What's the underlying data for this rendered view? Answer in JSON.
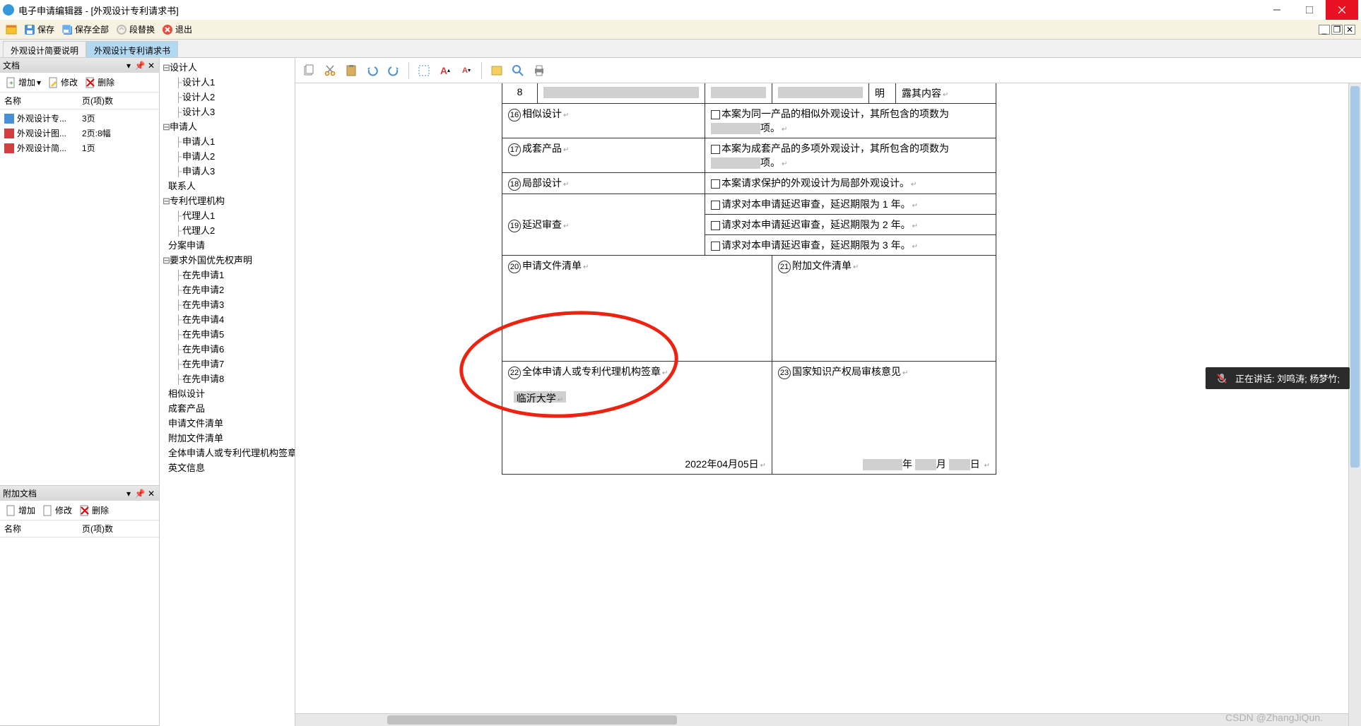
{
  "window": {
    "title": "电子申请编辑器 - [外观设计专利请求书]"
  },
  "toolbar": {
    "save": "保存",
    "save_all": "保存全部",
    "replace": "段替换",
    "exit": "退出"
  },
  "tabs": [
    {
      "label": "外观设计简要说明",
      "active": false
    },
    {
      "label": "外观设计专利请求书",
      "active": true
    }
  ],
  "panels": {
    "docs": {
      "title": "文档",
      "toolbar": {
        "add": "增加",
        "modify": "修改",
        "delete": "删除"
      },
      "columns": {
        "name": "名称",
        "pages": "页(项)数"
      },
      "items": [
        {
          "name": "外观设计专...",
          "pages": "3页",
          "icon": "doc-blue"
        },
        {
          "name": "外观设计图...",
          "pages": "2页:8幅",
          "icon": "doc-red"
        },
        {
          "name": "外观设计简...",
          "pages": "1页",
          "icon": "doc-red"
        }
      ]
    },
    "attach": {
      "title": "附加文档",
      "toolbar": {
        "add": "增加",
        "modify": "修改",
        "delete": "删除"
      },
      "columns": {
        "name": "名称",
        "pages": "页(项)数"
      },
      "items": []
    }
  },
  "outline": [
    {
      "label": "设计人",
      "children": [
        "设计人1",
        "设计人2",
        "设计人3"
      ]
    },
    {
      "label": "申请人",
      "children": [
        "申请人1",
        "申请人2",
        "申请人3"
      ]
    },
    {
      "label": "联系人",
      "children": []
    },
    {
      "label": "专利代理机构",
      "children": [
        "代理人1",
        "代理人2"
      ]
    },
    {
      "label": "分案申请",
      "children": []
    },
    {
      "label": "要求外国优先权声明",
      "children": [
        "在先申请1",
        "在先申请2",
        "在先申请3",
        "在先申请4",
        "在先申请5",
        "在先申请6",
        "在先申请7",
        "在先申请8"
      ]
    },
    {
      "label": "相似设计",
      "children": []
    },
    {
      "label": "成套产品",
      "children": []
    },
    {
      "label": "申请文件清单",
      "children": []
    },
    {
      "label": "附加文件清单",
      "children": []
    },
    {
      "label": "全体申请人或专利代理机构签章",
      "children": []
    },
    {
      "label": "英文信息",
      "children": []
    }
  ],
  "form": {
    "top_number": "8",
    "top_right1": "明",
    "top_right2": "露其内容",
    "r16_label": "相似设计",
    "r16_text": "本案为同一产品的相似外观设计，其所包含的项数为",
    "r16_suffix": "项。",
    "r17_label": "成套产品",
    "r17_text": "本案为成套产品的多项外观设计，其所包含的项数为",
    "r17_suffix": "项。",
    "r18_label": "局部设计",
    "r18_text": "本案请求保护的外观设计为局部外观设计。",
    "r19_label": "延迟审查",
    "r19_opt1": "请求对本申请延迟审查，延迟期限为 1 年。",
    "r19_opt2": "请求对本申请延迟审查，延迟期限为 2 年。",
    "r19_opt3": "请求对本申请延迟审查，延迟期限为 3 年。",
    "r20_label": "申请文件清单",
    "r21_label": "附加文件清单",
    "r22_label": "全体申请人或专利代理机构签章",
    "r22_value": "临沂大学",
    "r22_date": "2022年04月05日",
    "r23_label": "国家知识产权局审核意见",
    "r23_date_y": "年",
    "r23_date_m": "月",
    "r23_date_d": "日"
  },
  "overlay": {
    "speaking": "正在讲话: 刘鸣涛; 杨梦竹;"
  },
  "watermark": "CSDN @ZhangJiQun."
}
